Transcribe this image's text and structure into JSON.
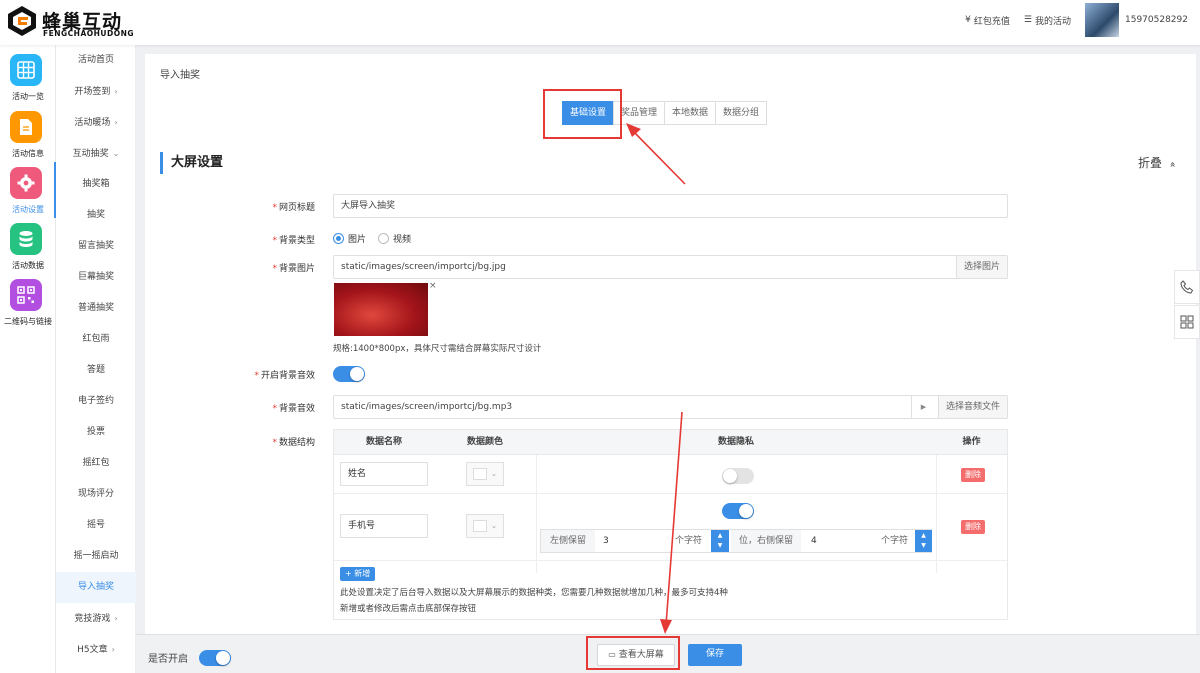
{
  "brand": {
    "cn": "蜂巢互动",
    "en": "FENGCHAOHUDONG"
  },
  "header": {
    "recharge": "红包充值",
    "recharge_icon": "¥",
    "my_activities": "我的活动",
    "my_activities_icon": "☰",
    "username": "15970528292"
  },
  "nav": [
    {
      "label": "活动一览",
      "icon": "grid-icon",
      "color": "#29b6f6"
    },
    {
      "label": "活动信息",
      "icon": "document-icon",
      "color": "#ff9800"
    },
    {
      "label": "活动设置",
      "icon": "gear-icon",
      "color": "#ef5a7c"
    },
    {
      "label": "活动数据",
      "icon": "database-icon",
      "color": "#26c281"
    },
    {
      "label": "二维码与链接",
      "icon": "qrcode-icon",
      "color": "#b34fe0"
    }
  ],
  "subnav": [
    {
      "label": "活动首页",
      "arrow": ""
    },
    {
      "label": "开场签到",
      "arrow": "›"
    },
    {
      "label": "活动暖场",
      "arrow": "›"
    },
    {
      "label": "互动抽奖",
      "arrow": "⌄"
    },
    {
      "label": "抽奖箱",
      "arrow": ""
    },
    {
      "label": "抽奖",
      "arrow": ""
    },
    {
      "label": "留言抽奖",
      "arrow": ""
    },
    {
      "label": "巨幕抽奖",
      "arrow": ""
    },
    {
      "label": "普通抽奖",
      "arrow": ""
    },
    {
      "label": "红包雨",
      "arrow": ""
    },
    {
      "label": "答题",
      "arrow": ""
    },
    {
      "label": "电子签约",
      "arrow": ""
    },
    {
      "label": "投票",
      "arrow": ""
    },
    {
      "label": "摇红包",
      "arrow": ""
    },
    {
      "label": "现场评分",
      "arrow": ""
    },
    {
      "label": "摇号",
      "arrow": ""
    },
    {
      "label": "摇一摇启动",
      "arrow": ""
    },
    {
      "label": "导入抽奖",
      "arrow": ""
    },
    {
      "label": "竞技游戏",
      "arrow": "›"
    },
    {
      "label": "H5文章",
      "arrow": "›"
    }
  ],
  "page": {
    "breadcrumb": "导入抽奖",
    "tabs": [
      "基础设置",
      "奖品管理",
      "本地数据",
      "数据分组"
    ],
    "section_title": "大屏设置",
    "fold": "折叠",
    "fold_icon": "»"
  },
  "form": {
    "title_label": "网页标题",
    "title_value": "大屏导入抽奖",
    "bg_type_label": "背景类型",
    "bg_type_options": [
      "图片",
      "视频"
    ],
    "bg_image_label": "背景图片",
    "bg_image_value": "static/images/screen/importcj/bg.jpg",
    "bg_image_button": "选择图片",
    "bg_image_hint": "规格:1400*800px，具体尺寸需结合屏幕实际尺寸设计",
    "bg_sound_switch_label": "开启背景音效",
    "bg_sound_label": "背景音效",
    "bg_sound_value": "static/images/screen/importcj/bg.mp3",
    "bg_sound_button": "选择音频文件",
    "data_label": "数据结构"
  },
  "table": {
    "headers": [
      "数据名称",
      "数据颜色",
      "数据隐私",
      "操作"
    ],
    "rows": [
      {
        "name": "姓名",
        "privacy_on": false,
        "delete": "删除"
      },
      {
        "name": "手机号",
        "privacy_on": true,
        "delete": "删除",
        "left_label": "左侧保留",
        "left_value": "3",
        "unit": "个字符",
        "mid_label": "位，右侧保留",
        "right_value": "4",
        "unit2": "个字符"
      }
    ],
    "add_button": "+ 新增",
    "note1": "此处设置决定了后台导入数据以及大屏幕展示的数据种类，您需要几种数据就增加几种，最多可支持4种",
    "note2": "新增或者修改后需点击底部保存按钮"
  },
  "bottom": {
    "enable_label": "是否开启",
    "view_screen": "查看大屏幕",
    "save": "保存"
  },
  "colors": {
    "accent": "#3a8ee6",
    "danger": "#f56c6c",
    "highlight": "#e53935"
  }
}
